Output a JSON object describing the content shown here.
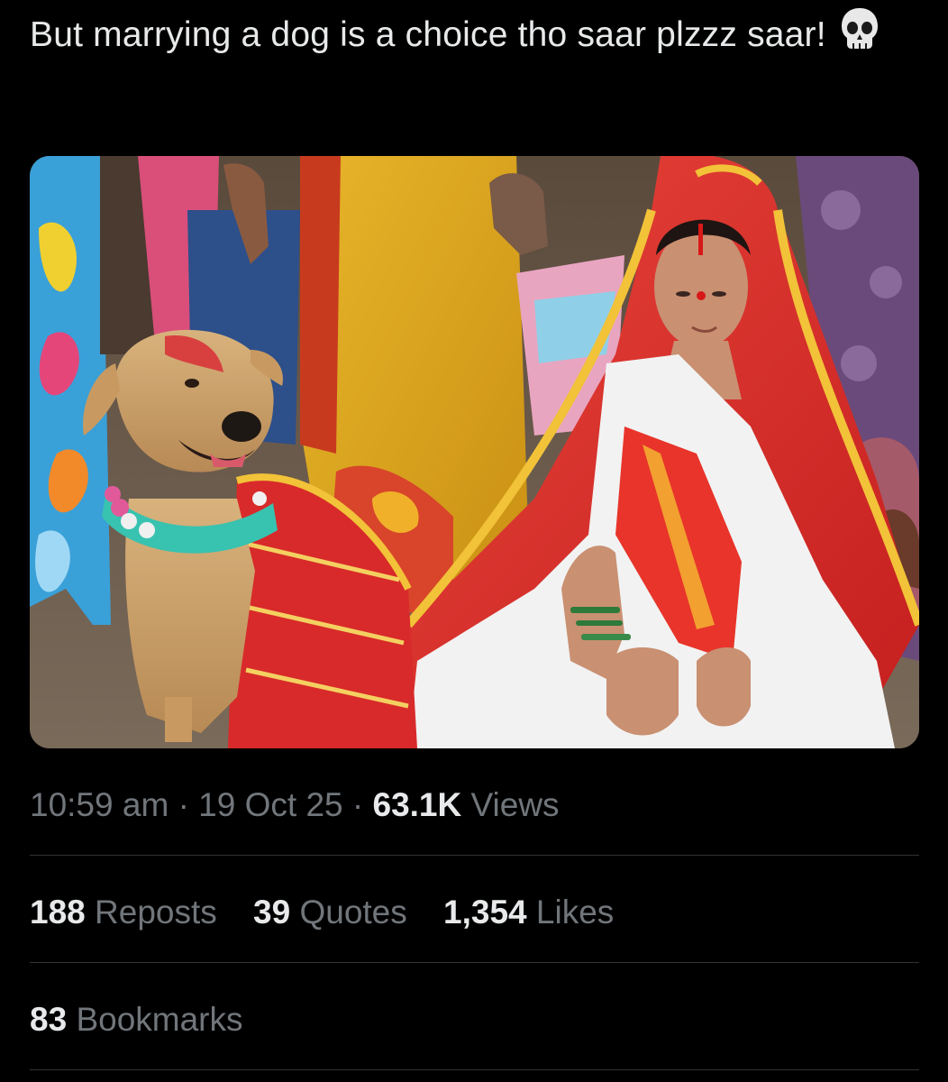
{
  "tweet": {
    "text": "But marrying a dog is a choice tho saar plzzz saar!",
    "emoji_icon": "skull-icon",
    "time": "10:59 am",
    "sep1": "·",
    "date": "19 Oct 25",
    "sep2": "·",
    "views_count": "63.1K",
    "views_label": "Views"
  },
  "stats": {
    "reposts_count": "188",
    "reposts_label": "Reposts",
    "quotes_count": "39",
    "quotes_label": "Quotes",
    "likes_count": "1,354",
    "likes_label": "Likes",
    "bookmarks_count": "83",
    "bookmarks_label": "Bookmarks"
  },
  "colors": {
    "background": "#000000",
    "text_primary": "#e7e9ea",
    "text_secondary": "#71767b",
    "divider": "#2f3336"
  }
}
